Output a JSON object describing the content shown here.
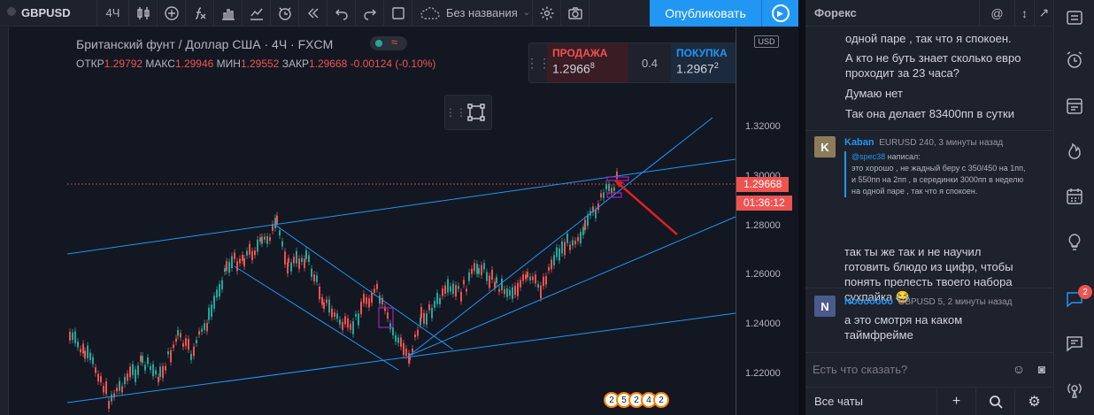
{
  "toolbar": {
    "symbol": "GBPUSD",
    "interval": "4Ч",
    "layout_name": "Без названия",
    "publish_label": "Опубликовать"
  },
  "legend": {
    "title": "Британский фунт / Доллар США · 4Ч · FXCM",
    "open_label": "ОТКР",
    "open": "1.29792",
    "high_label": "МАКС",
    "high": "1.29946",
    "low_label": "МИН",
    "low": "1.29552",
    "close_label": "ЗАКР",
    "close": "1.29668",
    "change": "-0.00124 (-0.10%)"
  },
  "trade_panel": {
    "sell_label": "ПРОДАЖА",
    "sell_main": "1.2966",
    "sell_sup": "8",
    "spread": "0.4",
    "buy_label": "ПОКУПКА",
    "buy_main": "1.2967",
    "buy_sup": "2",
    "plus": "+",
    "minus": "−",
    "info": "i"
  },
  "price_axis": {
    "currency": "USD",
    "ticks": [
      "1.32000",
      "1.30000",
      "1.28000",
      "1.26000",
      "1.24000",
      "1.22000"
    ],
    "last_price": "1.29668",
    "countdown": "01:36:12"
  },
  "bottom_badges": [
    "2",
    "5",
    "2",
    "4",
    "2"
  ],
  "chat": {
    "title": "Форекс",
    "prev_lines": [
      "одной паре , так что я спокоен."
    ],
    "messages_plain": [
      "А кто не буть знает сколько евро проходит за 23 часа?",
      "Думаю нет",
      "Так она делает 83400пп в сутки"
    ],
    "msg1": {
      "avatar": "K",
      "avatar_color": "#8d7c5c",
      "user": "Kaban",
      "meta": "EURUSD 240, 3 минуты назад",
      "quote_mention": "@spec38",
      "quote_wrote": " написал:",
      "quote_text": "это хорошо , не жадный беру с 350/450 на 1пп, и 550пп на 2пп , в серединки 3000пп в неделю на одной паре , так что я спокоен.",
      "text": "так ты же так и не научил готовить блюдо из цифр, чтобы понять прелесть твоего набора сухпайка 😂"
    },
    "msg2": {
      "avatar": "N",
      "avatar_color": "#4a5a8c",
      "user": "Nooooooo",
      "meta": "GBPUSD 5, 2 минуты назад",
      "text": "а это смотря на каком таймфрейме"
    },
    "input_placeholder": "Есть что сказать?",
    "footer_label": "Все чаты"
  },
  "rail": {
    "notification_count": "2"
  },
  "colors": {
    "accent": "#2196f3",
    "down": "#ef5350",
    "up": "#26a69a"
  }
}
